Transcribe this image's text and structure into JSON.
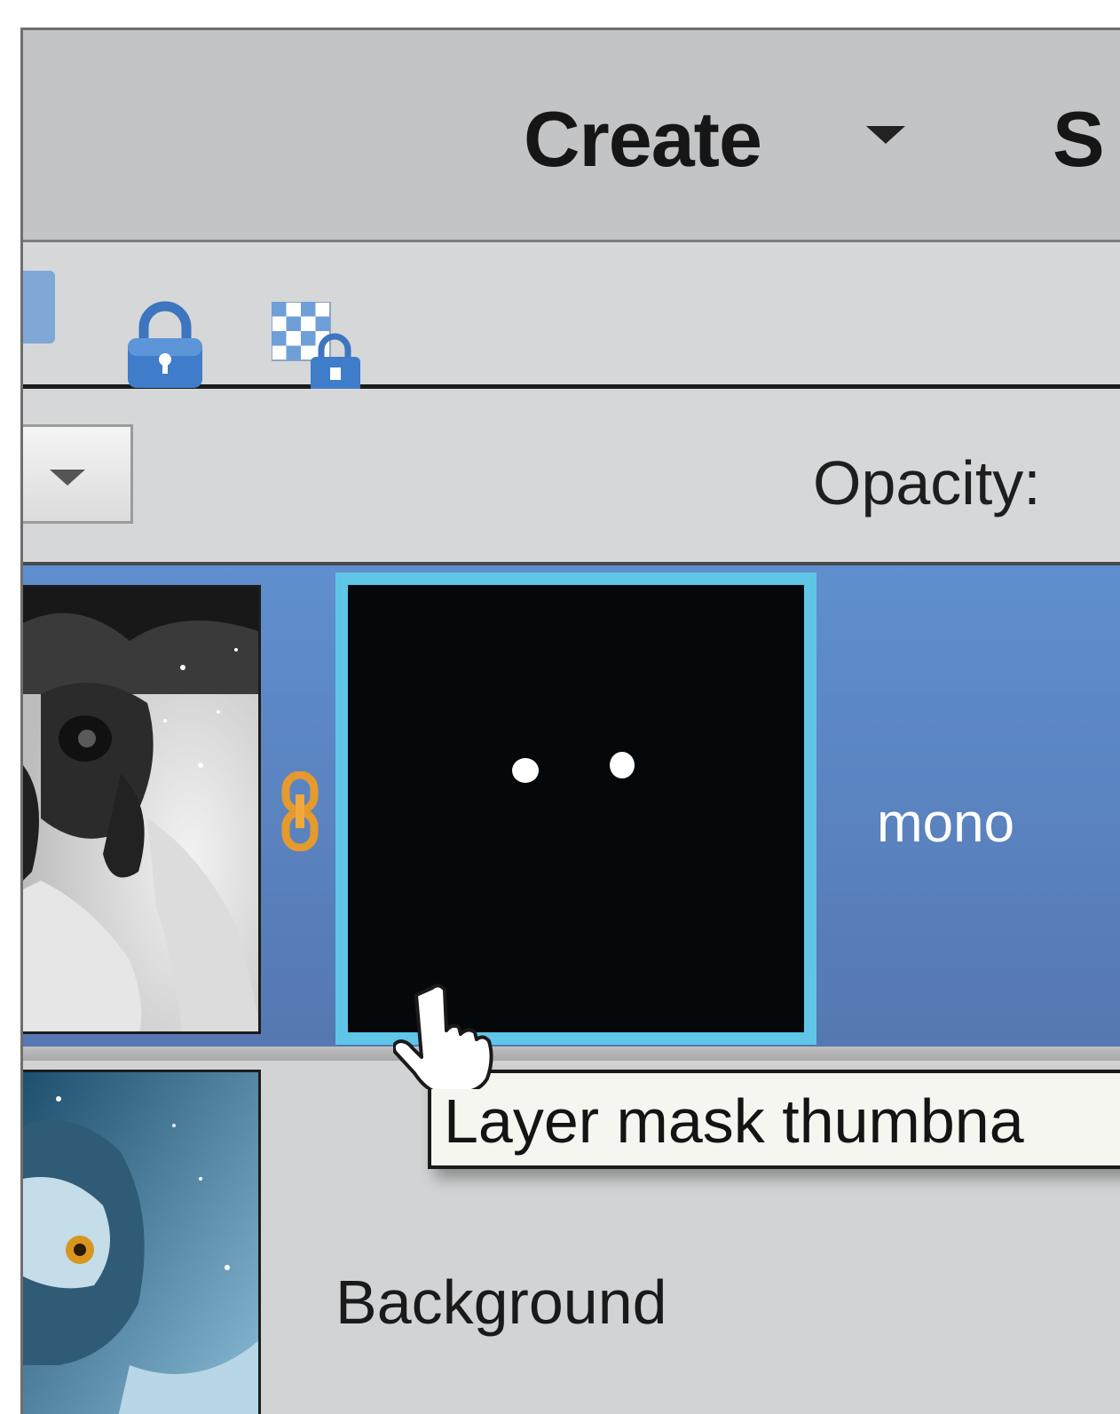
{
  "menu": {
    "create_label": "Create",
    "next_label": "S"
  },
  "toolbar": {
    "lock_all_icon": "lock-icon",
    "lock_transparency_icon": "lock-transparency-icon",
    "accent": "#3f7cc9"
  },
  "options": {
    "opacity_label": "Opacity:"
  },
  "layers": [
    {
      "name": "mono",
      "selected": true,
      "has_mask": true
    },
    {
      "name": "Background",
      "selected": false,
      "has_mask": false
    }
  ],
  "tooltip": {
    "text": "Layer mask thumbna"
  },
  "colors": {
    "selection": "#5f8fce",
    "mask_highlight": "#5fc6e8",
    "link_icon": "#e49a2e"
  }
}
